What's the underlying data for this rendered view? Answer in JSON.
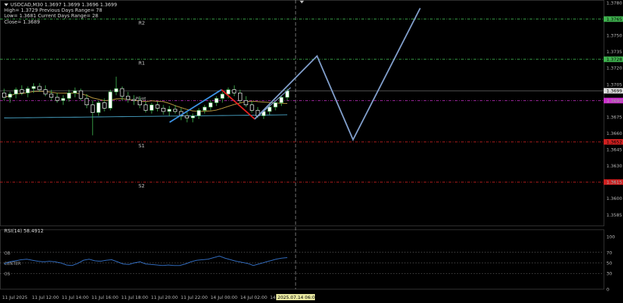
{
  "header": {
    "symbol_line": "USDCAD,M30  1.3697 1.3699 1.3696 1.3699",
    "line2": "High= 1.3729    Previous Days Range= 78",
    "line3": "Low= 1.3681    Current Days Range= 28",
    "line4": "Close= 1.3689"
  },
  "colors": {
    "background": "#000000",
    "grid": "#1f3a1f",
    "candle_up": "#ffffff",
    "candle_down": "#ffffff",
    "wick": "#3fb34f",
    "ma_fast": "#d7b04a",
    "ma_slow": "#4fb3d9",
    "wave_up": "#3b8fe0",
    "wave_down": "#e02020",
    "projection": "#7f9cc8",
    "resistance": "#3fb34f",
    "pivot": "#d030d0",
    "support": "#d02020",
    "rsi_line": "#3b7fe0"
  },
  "chart_data": {
    "type": "line",
    "symbol": "USDCAD",
    "timeframe": "M30",
    "ylim": [
      1.3575,
      1.378
    ],
    "y_ticks": [
      "1.3780",
      "1.3750",
      "1.3735",
      "1.3720",
      "1.3705",
      "1.3690",
      "1.3675",
      "1.3660",
      "1.3645",
      "1.3630",
      "1.3615",
      "1.3600",
      "1.3585"
    ],
    "x_ticks": [
      "11 Jul 2025",
      "11 Jul 12:00",
      "11 Jul 14:00",
      "11 Jul 16:00",
      "11 Jul 18:00",
      "11 Jul 20:00",
      "11 Jul 22:00",
      "14 Jul 00:00",
      "14 Jul 02:00",
      "14 Jul"
    ],
    "cursor_time": "2025.07.14 06:00",
    "levels": [
      {
        "name": "R2",
        "value": 1.3765,
        "price_tag": "1.3765",
        "color": "#3fb34f"
      },
      {
        "name": "R1",
        "value": 1.3728,
        "price_tag": "1.3728",
        "color": "#3fb34f"
      },
      {
        "name": "Pivot",
        "value": 1.369,
        "price_tag": "1.3690",
        "color": "#d030d0"
      },
      {
        "name": "S1",
        "value": 1.3652,
        "price_tag": "1.3652",
        "color": "#d02020"
      },
      {
        "name": "S2",
        "value": 1.3615,
        "price_tag": "1.3615",
        "color": "#d02020"
      }
    ],
    "current_price": {
      "value": 1.3699,
      "price_tag": "1.3699"
    },
    "candles": [
      [
        1.3697,
        1.3701,
        1.369,
        1.3693
      ],
      [
        1.3693,
        1.3698,
        1.3688,
        1.3696
      ],
      [
        1.3696,
        1.3702,
        1.3692,
        1.37
      ],
      [
        1.37,
        1.3704,
        1.3695,
        1.3697
      ],
      [
        1.3697,
        1.3703,
        1.3693,
        1.3701
      ],
      [
        1.3701,
        1.3706,
        1.3697,
        1.3703
      ],
      [
        1.3703,
        1.3706,
        1.3698,
        1.37
      ],
      [
        1.37,
        1.3704,
        1.3694,
        1.3696
      ],
      [
        1.3696,
        1.37,
        1.369,
        1.3693
      ],
      [
        1.3693,
        1.3697,
        1.3688,
        1.369
      ],
      [
        1.369,
        1.3695,
        1.3686,
        1.3692
      ],
      [
        1.3692,
        1.37,
        1.3689,
        1.3697
      ],
      [
        1.3697,
        1.3702,
        1.3693,
        1.3699
      ],
      [
        1.3699,
        1.3701,
        1.369,
        1.3692
      ],
      [
        1.3692,
        1.3696,
        1.3683,
        1.3686
      ],
      [
        1.3686,
        1.369,
        1.3658,
        1.3679
      ],
      [
        1.3679,
        1.369,
        1.3676,
        1.3688
      ],
      [
        1.3688,
        1.3692,
        1.368,
        1.3683
      ],
      [
        1.3683,
        1.37,
        1.3681,
        1.3698
      ],
      [
        1.3698,
        1.3712,
        1.3695,
        1.3701
      ],
      [
        1.3701,
        1.3703,
        1.369,
        1.3694
      ],
      [
        1.3694,
        1.3698,
        1.3688,
        1.3691
      ],
      [
        1.3691,
        1.3695,
        1.3686,
        1.369
      ],
      [
        1.369,
        1.3694,
        1.3683,
        1.3686
      ],
      [
        1.3686,
        1.3689,
        1.3679,
        1.3681
      ],
      [
        1.3681,
        1.3688,
        1.3678,
        1.3686
      ],
      [
        1.3686,
        1.3689,
        1.368,
        1.3683
      ],
      [
        1.3683,
        1.3686,
        1.3677,
        1.368
      ],
      [
        1.368,
        1.3685,
        1.3676,
        1.3682
      ],
      [
        1.3682,
        1.3686,
        1.3678,
        1.368
      ],
      [
        1.368,
        1.3683,
        1.3672,
        1.3676
      ],
      [
        1.3676,
        1.368,
        1.367,
        1.3674
      ],
      [
        1.3674,
        1.3678,
        1.367,
        1.3676
      ],
      [
        1.3676,
        1.3683,
        1.3673,
        1.3681
      ],
      [
        1.3681,
        1.3686,
        1.3678,
        1.3684
      ],
      [
        1.3684,
        1.369,
        1.3681,
        1.3688
      ],
      [
        1.3688,
        1.3694,
        1.3685,
        1.3692
      ],
      [
        1.3692,
        1.3698,
        1.3688,
        1.3696
      ],
      [
        1.3696,
        1.3702,
        1.3692,
        1.37
      ],
      [
        1.37,
        1.3704,
        1.3694,
        1.3697
      ],
      [
        1.3697,
        1.37,
        1.3688,
        1.369
      ],
      [
        1.369,
        1.3694,
        1.3684,
        1.3686
      ],
      [
        1.3686,
        1.3689,
        1.3679,
        1.3681
      ],
      [
        1.3681,
        1.3684,
        1.3674,
        1.3676
      ],
      [
        1.3676,
        1.3682,
        1.3673,
        1.368
      ],
      [
        1.368,
        1.3686,
        1.3677,
        1.3684
      ],
      [
        1.3684,
        1.369,
        1.3681,
        1.3688
      ],
      [
        1.3688,
        1.3695,
        1.3685,
        1.3693
      ],
      [
        1.3693,
        1.3701,
        1.369,
        1.3699
      ]
    ],
    "wave": [
      {
        "x": 0.3,
        "y": 1.3672,
        "leg": "up"
      },
      {
        "x": 0.44,
        "y": 1.37,
        "leg": "down"
      },
      {
        "x": 0.525,
        "y": 1.3673,
        "leg": "up"
      }
    ],
    "projection": [
      {
        "t": 0.525,
        "y": 1.3673
      },
      {
        "t": 0.62,
        "y": 1.3731
      },
      {
        "t": 0.69,
        "y": 1.3654
      },
      {
        "t": 0.82,
        "y": 1.3775
      }
    ],
    "rsi": {
      "label": "RSI(14) 58.4912",
      "levels": [
        {
          "name": "OB",
          "value": 70
        },
        {
          "name": "CENTER",
          "value": 50
        },
        {
          "name": "OS",
          "value": 30
        }
      ],
      "y_ticks": [
        "100",
        "70",
        "50",
        "30",
        "0"
      ],
      "values": [
        48,
        52,
        54,
        56,
        57,
        55,
        53,
        52,
        53,
        52,
        50,
        46,
        45,
        49,
        55,
        57,
        54,
        53,
        55,
        56,
        52,
        48,
        47,
        50,
        52,
        48,
        47,
        46,
        45,
        46,
        45,
        45,
        48,
        52,
        55,
        56,
        57,
        60,
        63,
        59,
        56,
        53,
        51,
        49,
        45,
        48,
        51,
        54,
        57,
        59,
        60
      ]
    }
  }
}
